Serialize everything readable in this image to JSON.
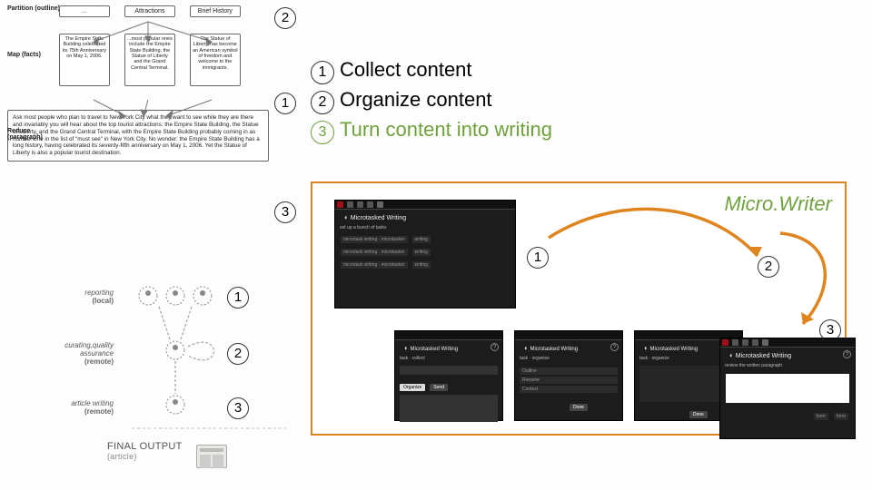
{
  "tree": {
    "partition_label": "Partition (outline)",
    "map_label": "Map (facts)",
    "reduce_label": "Reduce (paragraph)",
    "row1": [
      "...",
      "Attractions",
      "Brief History"
    ],
    "row2": [
      "The Empire State Building celebrated its 75th Anniversary on May 1, 2006.",
      "...most popular ones include the Empire State Building, the Statue of Liberty and the Grand Central Terminal.",
      "The Statue of Liberty has become an American symbol of freedom and welcome to the immigrants."
    ],
    "paragraph": "Ask most people who plan to travel to New York City what they want to see while they are there and invariably you will hear about the top tourist attractions: the Empire State Building, the Statue of Liberty, and the Grand Central Terminal, with the Empire State Building probably coming in as number one in the list of \"must see\" in New York City. No wonder: the Empire State Building has a long history, having celebrated its seventy-fifth anniversary on May 1, 2006. Yet the Statue of Liberty is also a popular tourist destination."
  },
  "legend": {
    "s1": "Collect content",
    "s2": "Organize content",
    "s3": "Turn content into writing"
  },
  "panel_title": "Micro.Writer",
  "shots": {
    "main_title": "Microtasked Writing",
    "main_sub": "set up a bunch of tasks",
    "sm_title": "Microtasked Writing"
  },
  "flow": {
    "l1a": "reporting",
    "l1b": "(local)",
    "l2a": "curating,",
    "l2b": "quality assurance",
    "l2c": "(remote)",
    "l3a": "article writing",
    "l3b": "(remote)",
    "final_a": "FINAL OUTPUT",
    "final_b": "(article)"
  },
  "nums": {
    "n1": "1",
    "n2": "2",
    "n3": "3"
  }
}
